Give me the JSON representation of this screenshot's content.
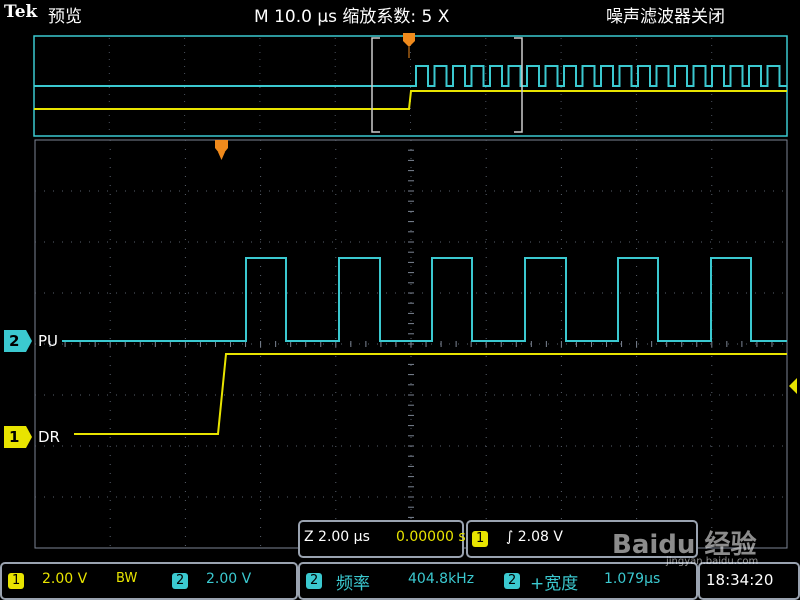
{
  "header": {
    "brand": "Tek",
    "mode": "预览",
    "timebase": "M 10.0 μs",
    "zoom_factor": "缩放系数: 5 X",
    "filter_status": "噪声滤波器关闭"
  },
  "channels": {
    "ch2": {
      "number": "2",
      "name": "PU",
      "color": "#3bc9d0",
      "scale": "2.00 V"
    },
    "ch1": {
      "number": "1",
      "name": "DR",
      "color": "#e8e400",
      "scale": "2.00 V"
    }
  },
  "zoom_readout": {
    "time_per_div": "Z 2.00 μs",
    "position": "0.00000 s"
  },
  "trigger_readout": {
    "source": "1",
    "slope_level": "∫ 2.08 V"
  },
  "bottom": {
    "ch1_scale": "2.00 V",
    "bw_label": "BW",
    "ch2_scale": "2.00 V",
    "meas1_source": "2",
    "meas1_name": "频率",
    "meas1_value": "404.8kHz",
    "meas2_source": "2",
    "meas2_name": "+宽度",
    "meas2_value": "1.079μs",
    "clock": "18:34:20"
  },
  "watermark": {
    "brand": "Baidu 经验",
    "url": "jingyan.baidu.com"
  }
}
